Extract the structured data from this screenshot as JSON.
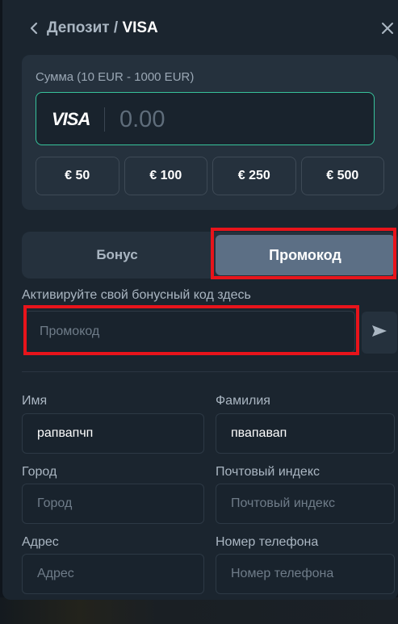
{
  "header": {
    "title_prefix": "Депозит / ",
    "title_method": "VISA"
  },
  "amount": {
    "label": "Сумма (10 EUR - 1000 EUR)",
    "brand": "VISA",
    "value": "0.00",
    "presets": [
      "€ 50",
      "€ 100",
      "€ 250",
      "€ 500"
    ]
  },
  "tabs": {
    "bonus": "Бонус",
    "promo": "Промокод",
    "active": "promo"
  },
  "promo": {
    "label": "Активируйте свой бонусный код здесь",
    "placeholder": "Промокод",
    "value": ""
  },
  "form": {
    "first_name": {
      "label": "Имя",
      "value": "рапвапчп",
      "placeholder": ""
    },
    "last_name": {
      "label": "Фамилия",
      "value": "пвапавап",
      "placeholder": ""
    },
    "city": {
      "label": "Город",
      "value": "",
      "placeholder": "Город"
    },
    "zip": {
      "label": "Почтовый индекс",
      "value": "",
      "placeholder": "Почтовый индекс"
    },
    "address": {
      "label": "Адрес",
      "value": "",
      "placeholder": "Адрес"
    },
    "phone": {
      "label": "Номер телефона",
      "value": "",
      "placeholder": "Номер телефона"
    }
  },
  "colors": {
    "panel": "#1b252f",
    "card": "#25313d",
    "input_bg": "#19232d",
    "accent_border": "#37c39b",
    "active_tab": "#5c6f85",
    "highlight": "#e8141b"
  },
  "icons": {
    "back": "chevron-left-icon",
    "close": "close-icon",
    "send": "send-icon"
  }
}
